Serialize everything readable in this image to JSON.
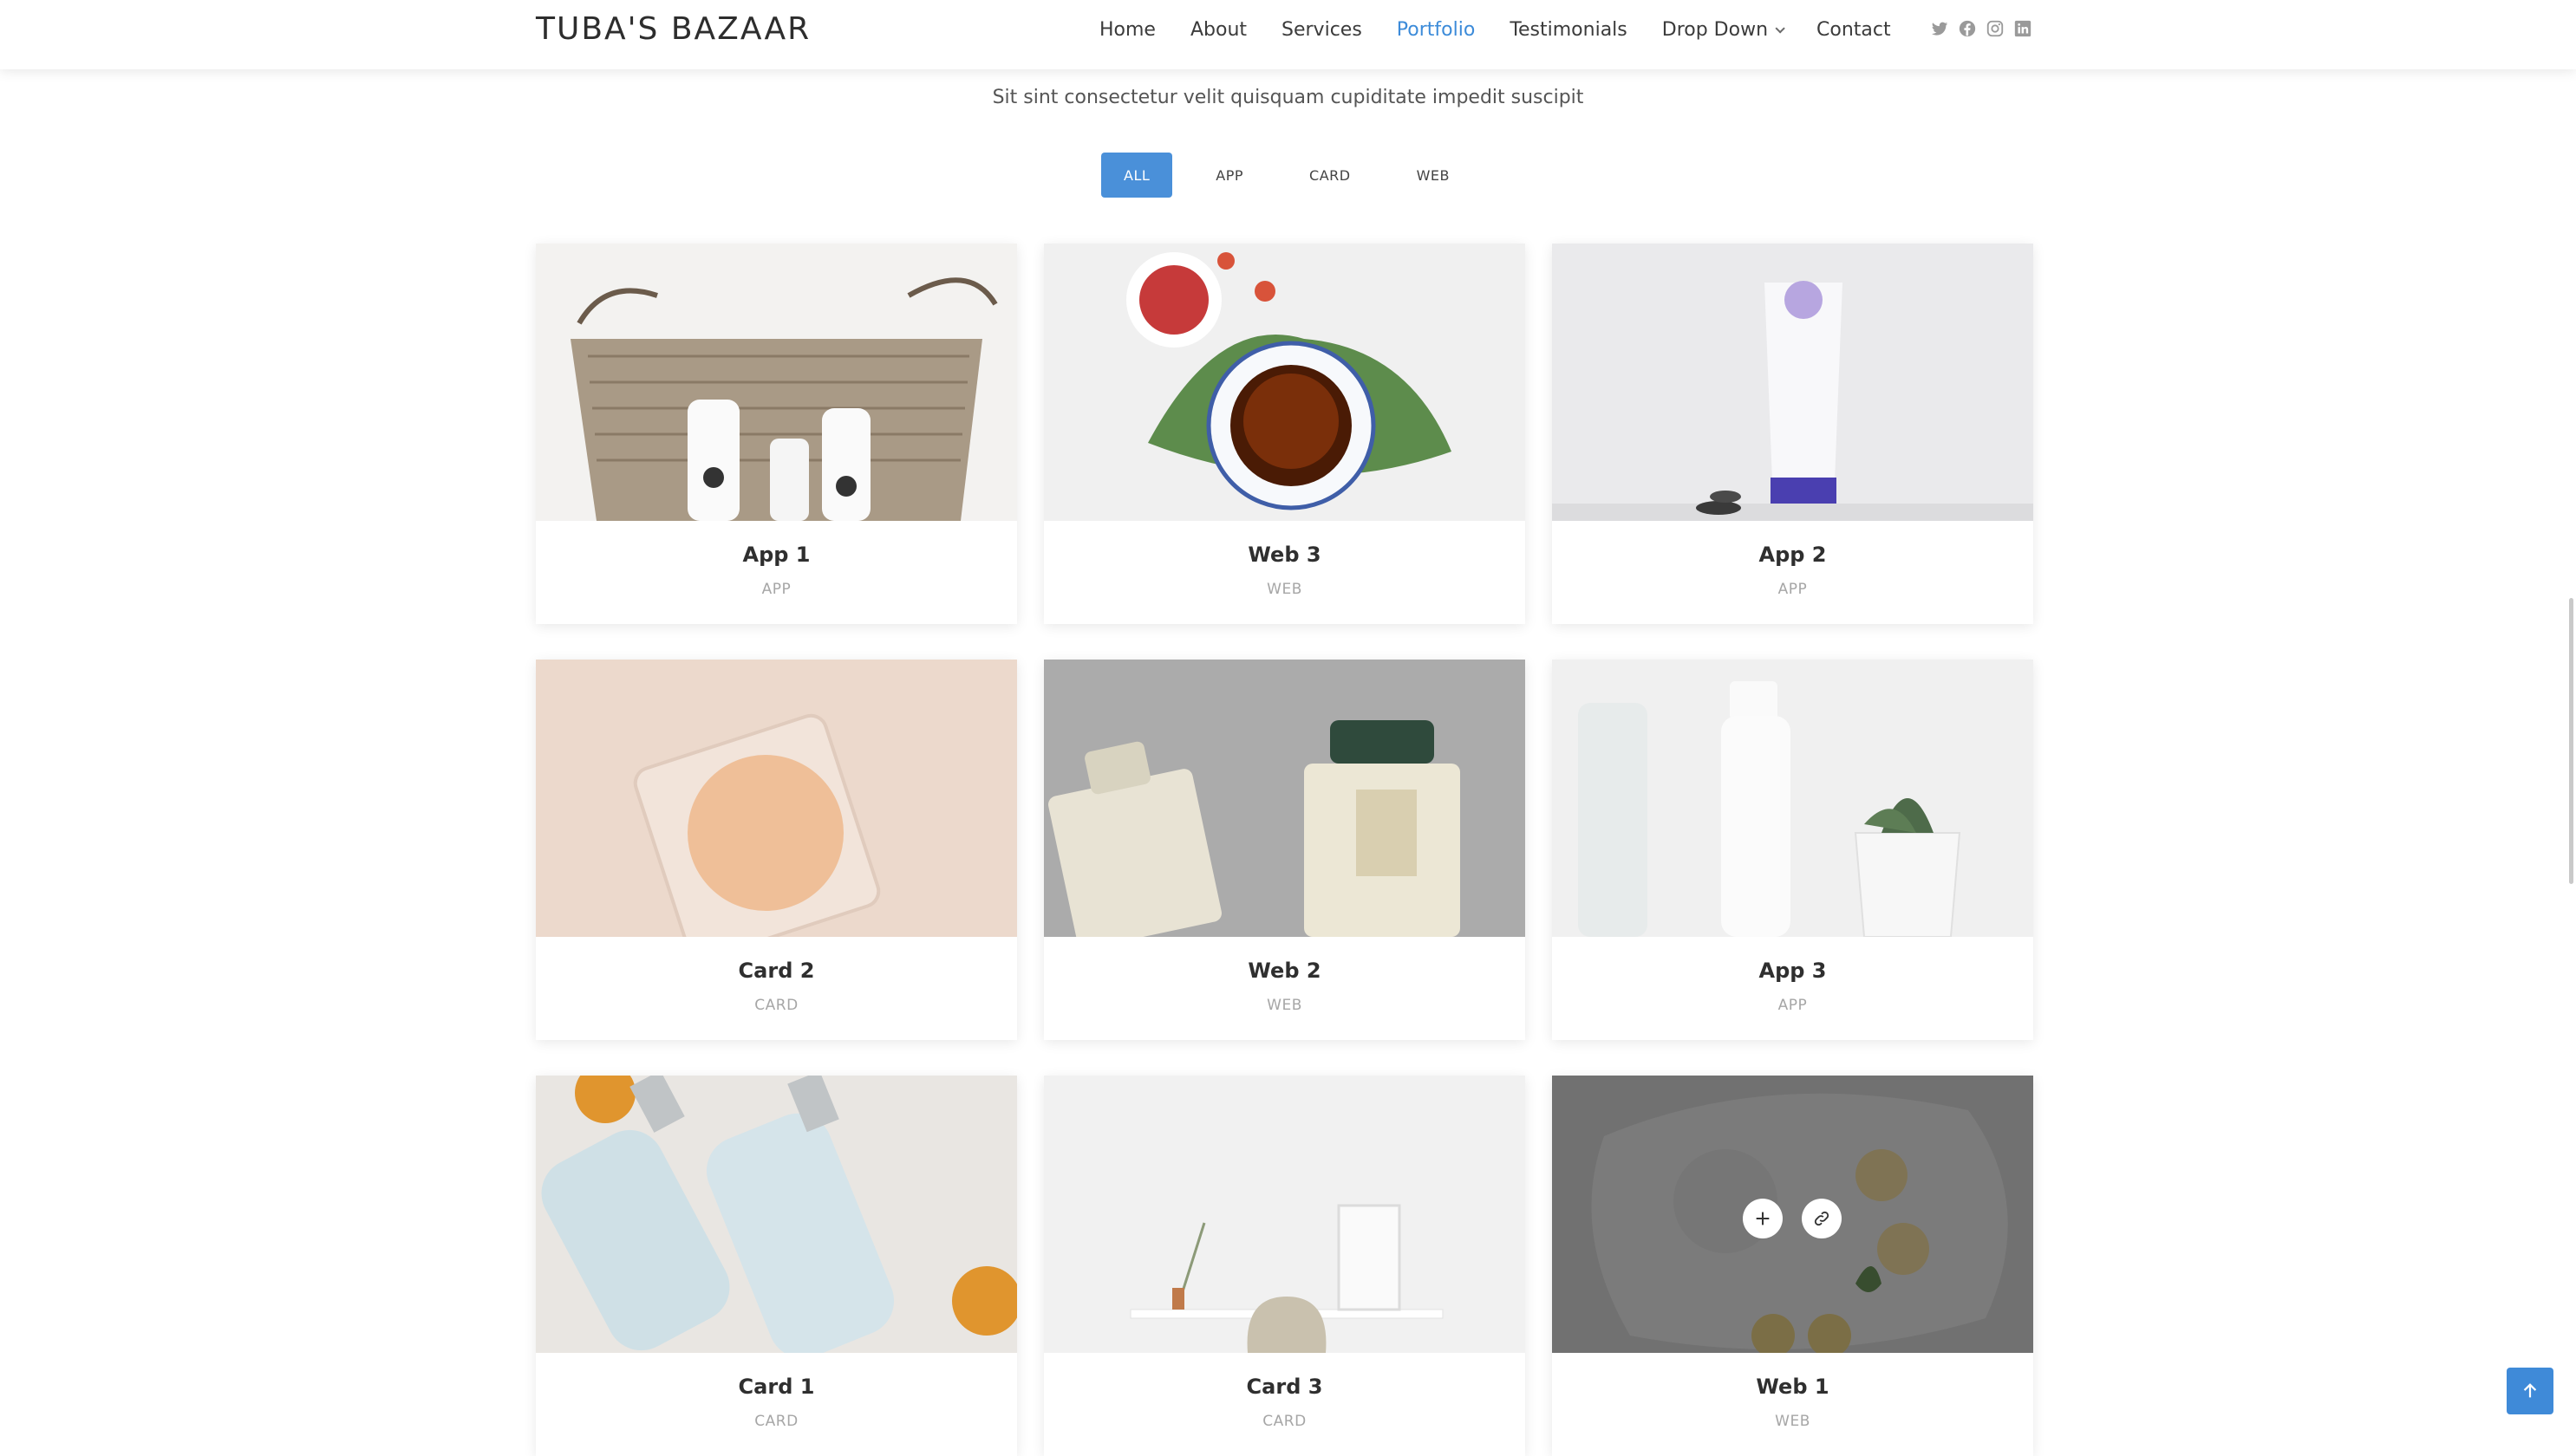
{
  "header": {
    "logo": "TUBA'S BAZAAR",
    "nav": [
      {
        "label": "Home"
      },
      {
        "label": "About"
      },
      {
        "label": "Services"
      },
      {
        "label": "Portfolio",
        "active": true
      },
      {
        "label": "Testimonials"
      },
      {
        "label": "Drop Down",
        "dropdown": true
      },
      {
        "label": "Contact"
      }
    ],
    "social_icons": [
      "twitter-icon",
      "facebook-icon",
      "instagram-icon",
      "linkedin-icon"
    ]
  },
  "portfolio": {
    "subtitle": "Sit sint consectetur velit quisquam cupiditate impedit suscipit",
    "filters": [
      {
        "label": "ALL",
        "active": true
      },
      {
        "label": "APP"
      },
      {
        "label": "CARD"
      },
      {
        "label": "WEB"
      }
    ],
    "items": [
      {
        "title": "App 1",
        "category": "APP"
      },
      {
        "title": "Web 3",
        "category": "WEB"
      },
      {
        "title": "App 2",
        "category": "APP"
      },
      {
        "title": "Card 2",
        "category": "CARD"
      },
      {
        "title": "Web 2",
        "category": "WEB"
      },
      {
        "title": "App 3",
        "category": "APP"
      },
      {
        "title": "Card 1",
        "category": "CARD"
      },
      {
        "title": "Card 3",
        "category": "CARD"
      },
      {
        "title": "Web 1",
        "category": "WEB"
      }
    ]
  },
  "colors": {
    "accent": "#3c8bd9",
    "filter_active": "#4a90d9",
    "back_to_top": "#3f8ad8"
  }
}
